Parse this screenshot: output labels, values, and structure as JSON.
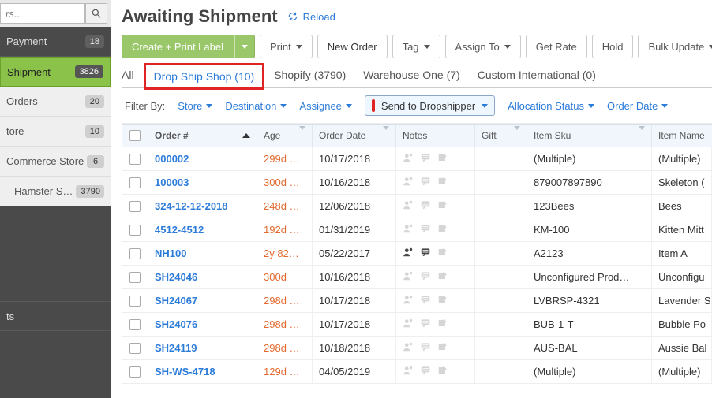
{
  "sidebar": {
    "search_placeholder": "rs...",
    "items": [
      {
        "label": "Payment",
        "badge": "18",
        "style": "dark"
      },
      {
        "label": "Shipment",
        "badge": "3826",
        "style": "active"
      },
      {
        "label": "Orders",
        "badge": "20",
        "style": "light"
      },
      {
        "label": "tore",
        "badge": "10",
        "style": "light"
      },
      {
        "label": "Commerce Store",
        "badge": "6",
        "style": "light"
      },
      {
        "label": "Hamster Sh…",
        "badge": "3790",
        "style": "light",
        "indent": true
      }
    ],
    "bottom_label": "ts"
  },
  "header": {
    "title": "Awaiting Shipment",
    "reload": "Reload"
  },
  "toolbar": {
    "create_print": "Create + Print Label",
    "print": "Print",
    "new_order": "New Order",
    "tag": "Tag",
    "assign_to": "Assign To",
    "get_rate": "Get Rate",
    "hold": "Hold",
    "bulk_update": "Bulk Update"
  },
  "tabs": [
    {
      "label": "All"
    },
    {
      "label": "Drop Ship Shop (10)",
      "highlighted": true
    },
    {
      "label": "Shopify (3790)"
    },
    {
      "label": "Warehouse One (7)"
    },
    {
      "label": "Custom International (0)"
    }
  ],
  "filters": {
    "label": "Filter By:",
    "store": "Store",
    "destination": "Destination",
    "assignee": "Assignee",
    "chip": "Send to Dropshipper",
    "allocation": "Allocation Status",
    "order_date": "Order Date"
  },
  "columns": {
    "order": "Order #",
    "age": "Age",
    "order_date": "Order Date",
    "notes": "Notes",
    "gift": "Gift",
    "item_sku": "Item Sku",
    "item_name": "Item Name"
  },
  "rows": [
    {
      "order": "000002",
      "age": "299d …",
      "date": "10/17/2018",
      "note_user": false,
      "note_chat": false,
      "sku": "(Multiple)",
      "name": "(Multiple)"
    },
    {
      "order": "100003",
      "age": "300d …",
      "date": "10/16/2018",
      "note_user": false,
      "note_chat": false,
      "sku": "879007897890",
      "name": "Skeleton ("
    },
    {
      "order": "324-12-12-2018",
      "age": "248d …",
      "date": "12/06/2018",
      "note_user": false,
      "note_chat": false,
      "sku": "123Bees",
      "name": "Bees"
    },
    {
      "order": "4512-4512",
      "age": "192d …",
      "date": "01/31/2019",
      "note_user": false,
      "note_chat": false,
      "sku": "KM-100",
      "name": "Kitten Mitt"
    },
    {
      "order": "NH100",
      "age": "2y 82…",
      "date": "05/22/2017",
      "note_user": true,
      "note_chat": true,
      "sku": "A2123",
      "name": "Item A"
    },
    {
      "order": "SH24046",
      "age": "300d",
      "date": "10/16/2018",
      "note_user": false,
      "note_chat": false,
      "sku": "Unconfigured Prod…",
      "name": "Unconfigu"
    },
    {
      "order": "SH24067",
      "age": "298d …",
      "date": "10/17/2018",
      "note_user": false,
      "note_chat": false,
      "sku": "LVBRSP-4321",
      "name": "Lavender S"
    },
    {
      "order": "SH24076",
      "age": "298d …",
      "date": "10/17/2018",
      "note_user": false,
      "note_chat": false,
      "sku": "BUB-1-T",
      "name": "Bubble Po"
    },
    {
      "order": "SH24119",
      "age": "298d …",
      "date": "10/18/2018",
      "note_user": false,
      "note_chat": false,
      "sku": "AUS-BAL",
      "name": "Aussie Bal"
    },
    {
      "order": "SH-WS-4718",
      "age": "129d …",
      "date": "04/05/2019",
      "note_user": false,
      "note_chat": false,
      "sku": "(Multiple)",
      "name": "(Multiple)"
    }
  ]
}
